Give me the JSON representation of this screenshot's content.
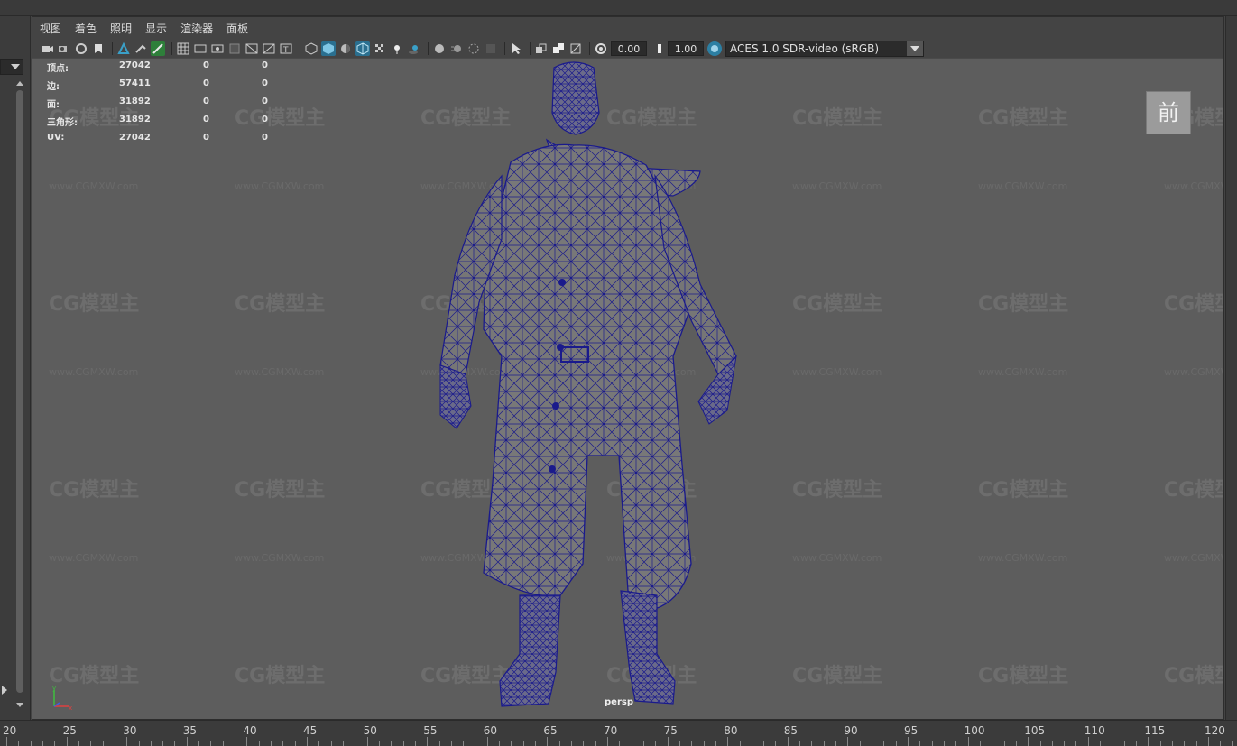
{
  "menubar": {
    "items": [
      "视图",
      "着色",
      "照明",
      "显示",
      "渲染器",
      "面板"
    ]
  },
  "toolbar": {
    "exposure_value": "0.00",
    "gamma_value": "1.00",
    "color_space": "ACES 1.0 SDR-video (sRGB)"
  },
  "hud": {
    "rows": [
      {
        "label": "顶点:",
        "v1": "27042",
        "v2": "0",
        "v3": "0"
      },
      {
        "label": "边:",
        "v1": "57411",
        "v2": "0",
        "v3": "0"
      },
      {
        "label": "面:",
        "v1": "31892",
        "v2": "0",
        "v3": "0"
      },
      {
        "label": "三角形:",
        "v1": "31892",
        "v2": "0",
        "v3": "0"
      },
      {
        "label": "UV:",
        "v1": "27042",
        "v2": "0",
        "v3": "0"
      }
    ]
  },
  "viewcube": {
    "label": "前"
  },
  "camera": {
    "name": "persp"
  },
  "watermark": {
    "brand": "CG模型主",
    "url": "www.CGMXW.com"
  },
  "axis": {
    "y_label": "y",
    "x_label": "x"
  },
  "ruler": {
    "ticks": [
      "20",
      "25",
      "30",
      "35",
      "40",
      "45",
      "50",
      "55",
      "60",
      "65",
      "70",
      "75",
      "80",
      "85",
      "90",
      "95",
      "100",
      "105",
      "110",
      "115",
      "120"
    ]
  },
  "colors": {
    "wireframe": "#1a1a8c",
    "viewport_bg": "#5d5d5d",
    "aces_icon": "#2c7fa3"
  }
}
